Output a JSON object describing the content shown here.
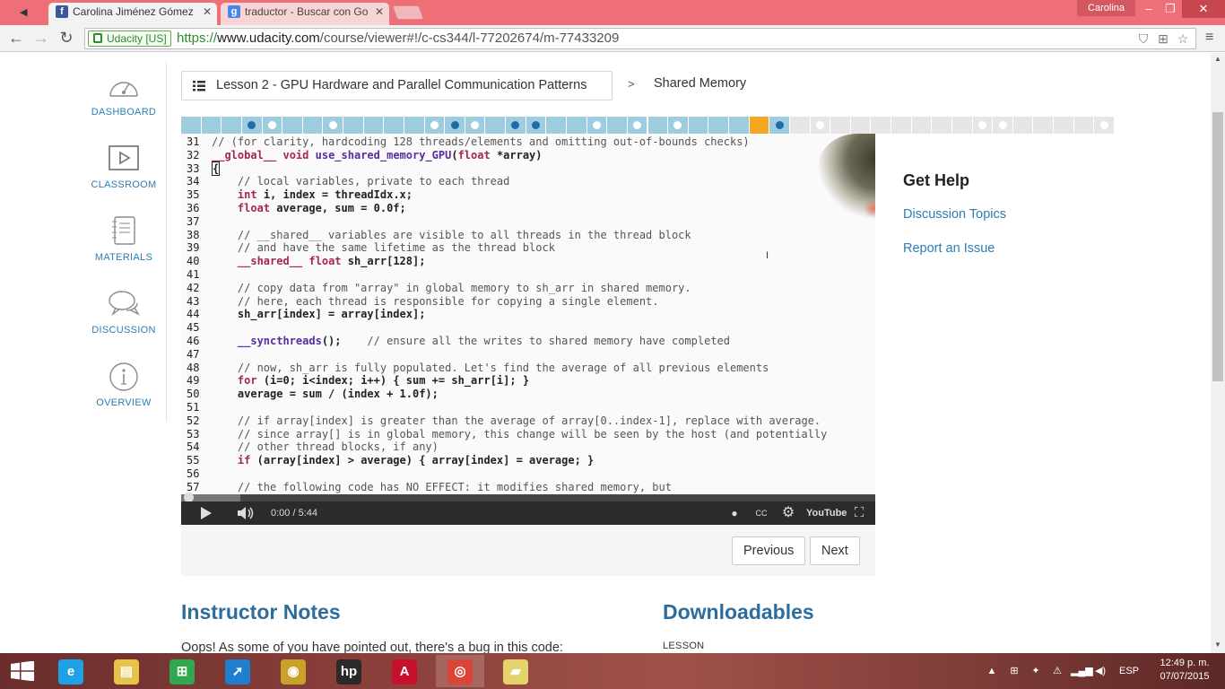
{
  "browser": {
    "tabs": [
      {
        "title": "Carolina Jiménez Gómez",
        "favicon": "facebook-icon",
        "active": true
      },
      {
        "title": "traductor - Buscar con Go",
        "favicon": "google-icon",
        "active": false
      }
    ],
    "user_badge": "Carolina",
    "window_controls": {
      "minimize": "–",
      "maximize": "❐",
      "close": "✕"
    },
    "ev_badge": "Udacity [US]",
    "url": {
      "scheme": "https://",
      "host": "www.udacity.com",
      "path": "/course/viewer#!/c-cs344/l-77202674/m-77433209"
    }
  },
  "sidebar": {
    "items": [
      {
        "label": "DASHBOARD",
        "icon": "gauge-icon"
      },
      {
        "label": "CLASSROOM",
        "icon": "play-icon"
      },
      {
        "label": "MATERIALS",
        "icon": "notebook-icon"
      },
      {
        "label": "DISCUSSION",
        "icon": "chat-bubbles-icon"
      },
      {
        "label": "OVERVIEW",
        "icon": "info-icon"
      }
    ]
  },
  "breadcrumb": {
    "lesson": "Lesson 2 - GPU Hardware and Parallel Communication Patterns",
    "separator": ">",
    "current": "Shared Memory"
  },
  "progress": {
    "colors": {
      "done": "#9fcde0",
      "current": "#f5a623",
      "todo": "#e6e6e6",
      "quiz_done_dot": "#1b6fa8",
      "dot_light": "#ffffff"
    },
    "segments": [
      "done",
      "done",
      "done",
      "done-quiz",
      "done-dot",
      "done",
      "done",
      "done-dot",
      "done",
      "done",
      "done",
      "done",
      "done-dot",
      "done-quiz",
      "done-dot",
      "done",
      "done-quiz",
      "done-quiz",
      "done",
      "done",
      "done-dot",
      "done",
      "done-dot",
      "done",
      "done-dot",
      "done",
      "done",
      "done",
      "current",
      "done-quiz",
      "todo",
      "todo-dot",
      "todo",
      "todo",
      "todo",
      "todo",
      "todo",
      "todo",
      "todo",
      "todo-dot",
      "todo-dot",
      "todo",
      "todo",
      "todo",
      "todo",
      "todo-dot"
    ]
  },
  "video": {
    "code_lines": [
      {
        "n": "31",
        "html": "<span class=\"cm\">// (for clarity, hardcoding 128 threads/elements and omitting out-of-bounds checks)</span>"
      },
      {
        "n": "32",
        "html": "<span class=\"kw\">__global__</span> <span class=\"kw\">void</span> <span class=\"fn\">use_shared_memory_GPU</span><span class=\"bold\">(</span><span class=\"kw\">float</span> <span class=\"bold\">*array)</span>"
      },
      {
        "n": "33",
        "html": "<span class=\"cursor bold\">{</span>"
      },
      {
        "n": "34",
        "html": "    <span class=\"cm\">// local variables, private to each thread</span>"
      },
      {
        "n": "35",
        "html": "    <span class=\"kw\">int</span> <span class=\"bold\">i, index = threadIdx.x;</span>"
      },
      {
        "n": "36",
        "html": "    <span class=\"kw\">float</span> <span class=\"bold\">average, sum = 0.0f;</span>"
      },
      {
        "n": "37",
        "html": ""
      },
      {
        "n": "38",
        "html": "    <span class=\"cm\">// __shared__ variables are visible to all threads in the thread block</span>"
      },
      {
        "n": "39",
        "html": "    <span class=\"cm\">// and have the same lifetime as the thread block</span>"
      },
      {
        "n": "40",
        "html": "    <span class=\"kw\">__shared__</span> <span class=\"kw\">float</span> <span class=\"bold\">sh_arr[128];</span>"
      },
      {
        "n": "41",
        "html": ""
      },
      {
        "n": "42",
        "html": "    <span class=\"cm\">// copy data from \"array\" in global memory to sh_arr in shared memory.</span>"
      },
      {
        "n": "43",
        "html": "    <span class=\"cm\">// here, each thread is responsible for copying a single element.</span>"
      },
      {
        "n": "44",
        "html": "    <span class=\"bold\">sh_arr[index] = array[index];</span>"
      },
      {
        "n": "45",
        "html": ""
      },
      {
        "n": "46",
        "html": "    <span class=\"fn\">__syncthreads</span><span class=\"bold\">();</span>    <span class=\"cm\">// ensure all the writes to shared memory have completed</span>"
      },
      {
        "n": "47",
        "html": ""
      },
      {
        "n": "48",
        "html": "    <span class=\"cm\">// now, sh_arr is fully populated. Let's find the average of all previous elements</span>"
      },
      {
        "n": "49",
        "html": "    <span class=\"kw\">for</span> <span class=\"bold\">(i=0; i&lt;index; i++) { sum += sh_arr[i]; }</span>"
      },
      {
        "n": "50",
        "html": "    <span class=\"bold\">average = sum / (index + 1.0f);</span>"
      },
      {
        "n": "51",
        "html": ""
      },
      {
        "n": "52",
        "html": "    <span class=\"cm\">// if array[index] is greater than the average of array[0..index-1], replace with average.</span>"
      },
      {
        "n": "53",
        "html": "    <span class=\"cm\">// since array[] is in global memory, this change will be seen by the host (and potentially</span>"
      },
      {
        "n": "54",
        "html": "    <span class=\"cm\">// other thread blocks, if any)</span>"
      },
      {
        "n": "55",
        "html": "    <span class=\"kw\">if</span> <span class=\"bold\">(array[index] &gt; average) { array[index] = average; }</span>"
      },
      {
        "n": "56",
        "html": ""
      },
      {
        "n": "57",
        "html": "    <span class=\"cm\">// the following code has NO EFFECT: it modifies shared memory, but</span>"
      }
    ],
    "time": "0:00 / 5:44",
    "youtube_label": "YouTube",
    "cc_label": "CC"
  },
  "nav": {
    "previous": "Previous",
    "next": "Next"
  },
  "help": {
    "title": "Get Help",
    "links": [
      "Discussion Topics",
      "Report an Issue"
    ]
  },
  "instructor_notes": {
    "title": "Instructor Notes",
    "text": "Oops! As some of you have pointed out, there's a bug in this code:"
  },
  "downloadables": {
    "title": "Downloadables",
    "label": "LESSON"
  },
  "taskbar": {
    "items": [
      {
        "name": "ie-taskbar-icon",
        "glyph": "e",
        "color": "#1ea1e6"
      },
      {
        "name": "file-explorer-taskbar-icon",
        "glyph": "▤",
        "color": "#e8c34a"
      },
      {
        "name": "store-taskbar-icon",
        "glyph": "⊞",
        "color": "#2fa84f"
      },
      {
        "name": "rocket-taskbar-icon",
        "glyph": "➚",
        "color": "#1e7fd1"
      },
      {
        "name": "media-taskbar-icon",
        "glyph": "◉",
        "color": "#c9a227"
      },
      {
        "name": "hp-taskbar-icon",
        "glyph": "hp",
        "color": "#2a2a2a"
      },
      {
        "name": "adobe-taskbar-icon",
        "glyph": "A",
        "color": "#c8102e"
      },
      {
        "name": "chrome-taskbar-icon",
        "glyph": "◎",
        "color": "#db4437"
      },
      {
        "name": "sticky-notes-taskbar-icon",
        "glyph": "▰",
        "color": "#e3d36a"
      }
    ],
    "language": "ESP",
    "time": "12:49 p. m.",
    "date": "07/07/2015"
  }
}
